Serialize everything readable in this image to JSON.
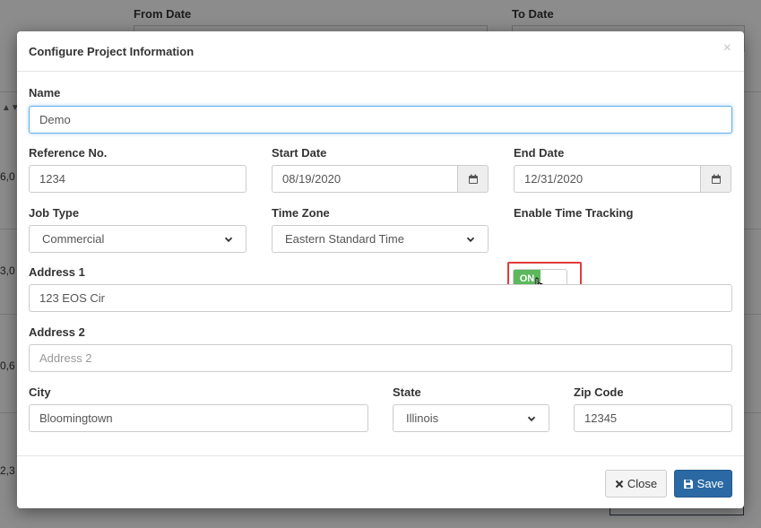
{
  "background": {
    "from_date_label": "From Date",
    "to_date_label": "To Date",
    "row_values": [
      "6,0",
      "3,0",
      "0,6",
      "2,3"
    ]
  },
  "modal": {
    "title": "Configure Project Information",
    "fields": {
      "name": {
        "label": "Name",
        "value": "Demo"
      },
      "reference_no": {
        "label": "Reference No.",
        "value": "1234"
      },
      "start_date": {
        "label": "Start Date",
        "value": "08/19/2020"
      },
      "end_date": {
        "label": "End Date",
        "value": "12/31/2020"
      },
      "job_type": {
        "label": "Job Type",
        "value": "Commercial"
      },
      "time_zone": {
        "label": "Time Zone",
        "value": "Eastern Standard Time"
      },
      "time_tracking": {
        "label": "Enable Time Tracking",
        "state_label": "ON"
      },
      "address1": {
        "label": "Address 1",
        "value": "123 EOS Cir"
      },
      "address2": {
        "label": "Address 2",
        "value": "",
        "placeholder": "Address 2"
      },
      "city": {
        "label": "City",
        "value": "Bloomingtown"
      },
      "state": {
        "label": "State",
        "value": "Illinois"
      },
      "zip": {
        "label": "Zip Code",
        "value": "12345"
      }
    },
    "buttons": {
      "close_label": "Close",
      "save_label": "Save"
    }
  },
  "colors": {
    "primary": "#2a69a4",
    "toggle_on": "#5cb85c",
    "highlight": "#e23b3b"
  },
  "icons": [
    "close-x-icon",
    "calendar-icon",
    "chevron-down-icon",
    "times-icon",
    "floppy-disk-icon",
    "hand-pointer-icon"
  ]
}
